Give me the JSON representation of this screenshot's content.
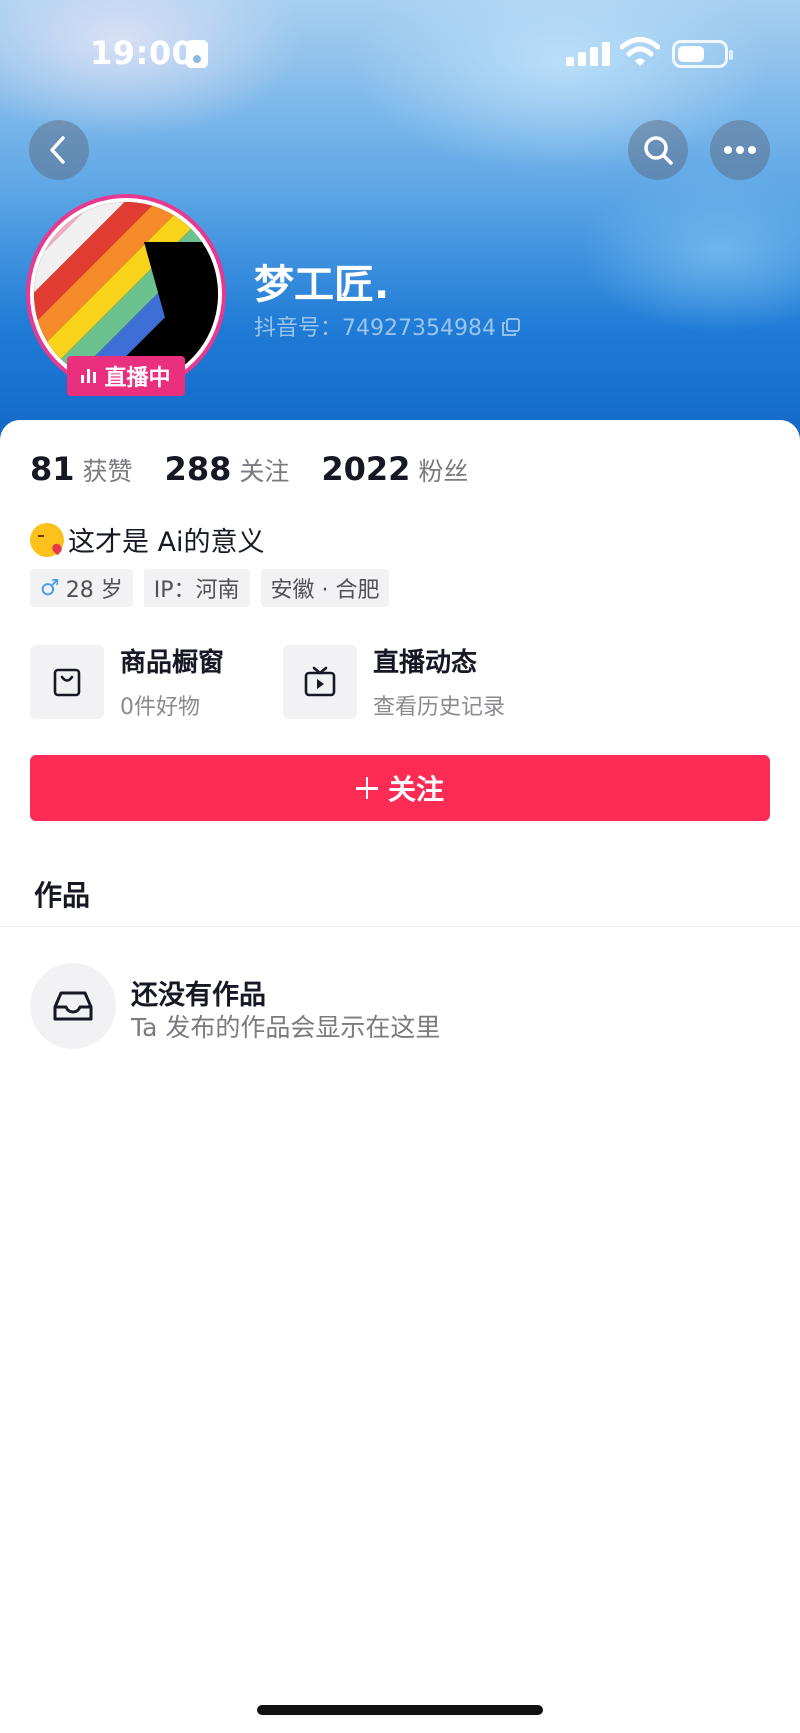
{
  "status_bar": {
    "time": "19:00",
    "icons": [
      "id-card-icon",
      "signal-icon",
      "wifi-icon",
      "battery-icon"
    ]
  },
  "top_nav": {
    "back_icon": "chevron-left-icon",
    "search_icon": "search-icon",
    "more_icon": "more-dots-icon"
  },
  "profile": {
    "live_badge": "直播中",
    "nickname": "梦工匠.",
    "douyin_id": "抖音号：74927354984"
  },
  "stats": [
    {
      "value": "81",
      "label": "获赞"
    },
    {
      "value": "288",
      "label": "关注"
    },
    {
      "value": "2022",
      "label": "粉丝"
    }
  ],
  "bio": "这才是 Ai的意义",
  "tags": {
    "age": "28 岁",
    "ip": "IP：河南",
    "location": "安徽 · 合肥"
  },
  "features": [
    {
      "title": "商品橱窗",
      "subtitle": "0件好物",
      "icon": "shopping-bag-icon"
    },
    {
      "title": "直播动态",
      "subtitle": "查看历史记录",
      "icon": "tv-play-icon"
    }
  ],
  "follow_button": "关注",
  "tabs": {
    "works": "作品"
  },
  "empty_state": {
    "title": "还没有作品",
    "subtitle": "Ta 发布的作品会显示在这里",
    "icon": "inbox-icon"
  },
  "colors": {
    "accent": "#fe2c55",
    "live_badge": "#ea2f7f",
    "header_blue": "#1f7bd6"
  }
}
